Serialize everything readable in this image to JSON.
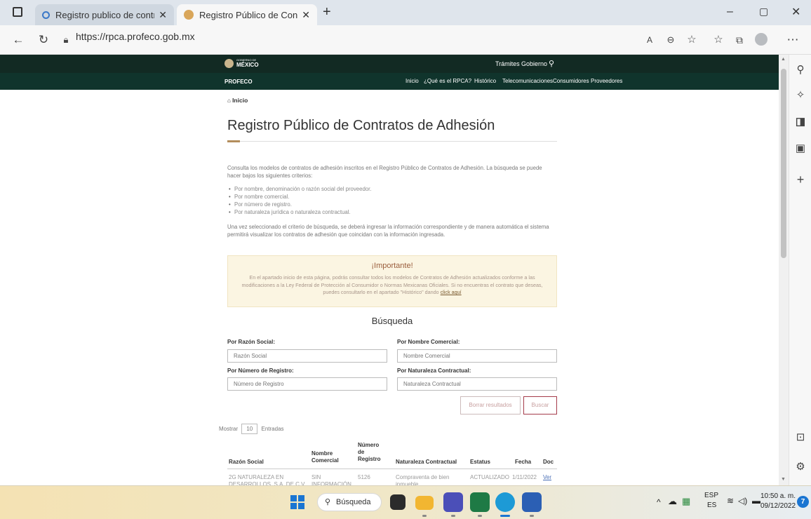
{
  "browser": {
    "tabs": [
      {
        "title": "Registro publico de contratos de",
        "icon": "search-icon"
      },
      {
        "title": "Registro Público de Contratos de",
        "icon": "site-favicon"
      }
    ],
    "url": "https://rpca.profeco.gob.mx"
  },
  "site": {
    "brand_top_small": "GOBIERNO DE",
    "brand_top": "MÉXICO",
    "top_links": [
      "Trámites",
      "Gobierno"
    ],
    "brand": "PROFECO",
    "nav": [
      "Inicio",
      "¿Qué es el RPCA?",
      "Histórico",
      "Telecomunicaciones",
      "Consumidores",
      "Proveedores"
    ]
  },
  "breadcrumb": "Inicio",
  "page_title": "Registro Público de Contratos de Adhesión",
  "intro": "Consulta los modelos de contratos de adhesión inscritos en el Registro Público de Contratos de Adhesión. La búsqueda se puede hacer bajos los siguientes criterios:",
  "criteria": [
    "Por nombre, denominación o razón social del proveedor.",
    "Por nombre comercial.",
    "Por número de registro.",
    "Por naturaleza jurídica o naturaleza contractual."
  ],
  "outro": "Una vez seleccionado el criterio de búsqueda, se deberá ingresar la información correspondiente y de manera automática el sistema permitirá visualizar los contratos de adhesión que coincidan con la información ingresada.",
  "alert": {
    "title": "¡Importante!",
    "body": "En el apartado inicio de esta página, podrás consultar todos los modelos de Contratos de Adhesión actualizados conforme a las modificaciones a la Ley Federal de Protección al Consumidor o Normas Mexicanas Oficiales. Si no encuentras el contrato que deseas, puedes consultarlo en el apartado \"Histórico\" dando",
    "link": "click aquí"
  },
  "search": {
    "heading": "Búsqueda",
    "razon_label": "Por Razón Social:",
    "razon_placeholder": "Razón Social",
    "nombre_label": "Por Nombre Comercial:",
    "nombre_placeholder": "Nombre Comercial",
    "numero_label": "Por Número de Registro:",
    "numero_placeholder": "Número de Registro",
    "naturaleza_label": "Por Naturaleza Contractual:",
    "naturaleza_placeholder": "Naturaleza Contractual",
    "clear_label": "Borrar resultados",
    "search_label": "Buscar"
  },
  "table": {
    "show_label": "Mostrar",
    "show_value": "10",
    "entries_label": "Entradas",
    "headers": [
      "Razón Social",
      "Nombre Comercial",
      "Número de Registro",
      "Naturaleza Contractual",
      "Estatus",
      "Fecha",
      "Doc"
    ],
    "rows": [
      [
        "2G NATURALEZA EN DESARROLLOS, S.A. DE C.V.",
        "SIN INFORMACIÓN",
        "5126",
        "Compraventa de bien inmueble",
        "ACTUALIZADO",
        "1/11/2022",
        "Ver"
      ]
    ]
  },
  "taskbar": {
    "search_label": "Búsqueda",
    "lang1": "ESP",
    "lang2": "ES",
    "time": "10:50 a. m.",
    "date": "09/12/2022",
    "badge": "7"
  },
  "colors": {
    "header_dark": "#122a23",
    "header_green": "#10342c",
    "accent_gold": "#b38e5d",
    "alert_bg": "#fbf5e2"
  }
}
